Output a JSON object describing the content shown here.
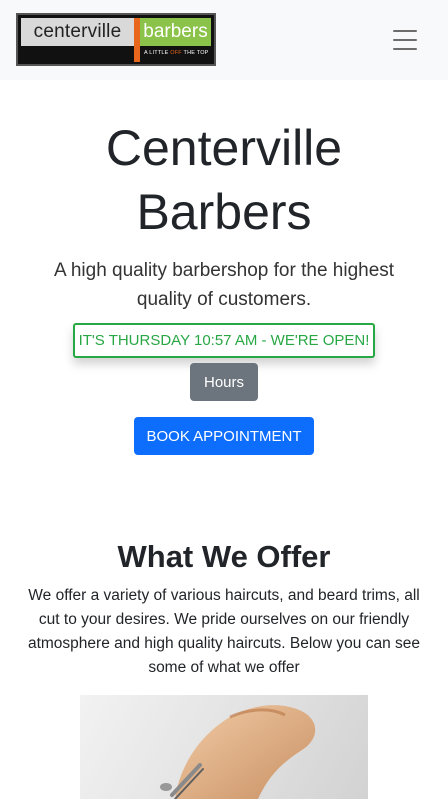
{
  "navbar": {
    "logo": {
      "left_text": "centerville",
      "right_text": "barbers",
      "tagline_a": "A LITTLE ",
      "tagline_off": "OFF",
      "tagline_b": " THE TOP"
    },
    "menu_icon": "hamburger-icon"
  },
  "hero": {
    "title_line1": "Centerville",
    "title_line2": "Barbers",
    "subtitle": "A high quality barbershop for the highest quality of customers.",
    "status": "IT'S THURSDAY 10:57 AM - WE'RE OPEN!",
    "hours_label": "Hours",
    "book_label": "BOOK APPOINTMENT"
  },
  "offer": {
    "title": "What We Offer",
    "text": "We offer a variety of various haircuts, and beard trims, all cut to your desires. We pride ourselves on our friendly atmosphere and high quality haircuts. Below you can see some of what we offer"
  },
  "colors": {
    "accent_blue": "#0d6efd",
    "open_green": "#28a745",
    "hours_gray": "#6c757d",
    "logo_green": "#8bc34a",
    "logo_orange": "#e8671d"
  }
}
